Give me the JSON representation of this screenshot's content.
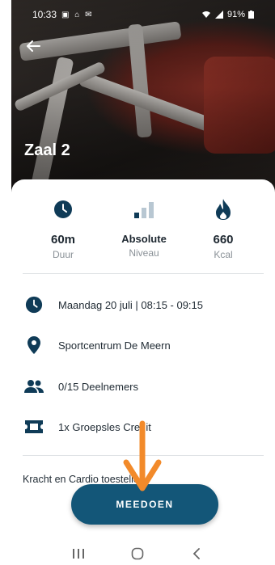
{
  "status_bar": {
    "time": "10:33",
    "left_icons": "▣ ⌂ ✉",
    "battery": "91%"
  },
  "hero": {
    "title": "Zaal 2"
  },
  "stats": [
    {
      "icon": "clock-icon",
      "value": "60m",
      "label": "Duur"
    },
    {
      "icon": "signal-bars-icon",
      "value": "Absolute",
      "label": "Niveau"
    },
    {
      "icon": "flame-icon",
      "value": "660",
      "label": "Kcal"
    }
  ],
  "details": {
    "date_time": "Maandag 20 juli | 08:15 - 09:15",
    "location": "Sportcentrum De Meern",
    "participants": "0/15 Deelnemers",
    "credit": "1x Groepsles Credit"
  },
  "description": "Kracht en Cardio toestellen",
  "join_button": "MEEDOEN",
  "colors": {
    "primary": "#135678",
    "icon": "#0f3b57",
    "annotation": "#f28a2a"
  }
}
